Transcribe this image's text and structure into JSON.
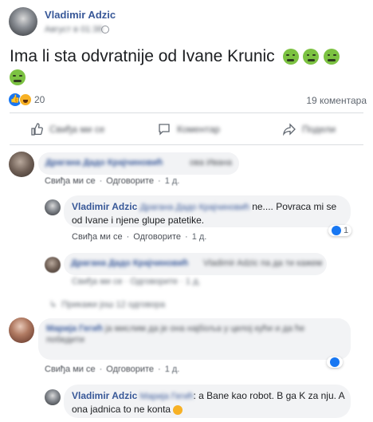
{
  "post": {
    "author": "Vladimir Adzic",
    "timestamp": "Август в 01:38",
    "text": "Ima li sta odvratnije od Ivane Krunic",
    "reaction_count": "20",
    "comments_count": "19 коментара"
  },
  "actions": {
    "like": "Свиђа ми се",
    "comment": "Коментар",
    "share": "Подели"
  },
  "comments": [
    {
      "author_blurred": "Драгана Дадо Крајчиновић",
      "text_blurred": "ова Ивана",
      "like_label": "Свиђа ми се",
      "reply_label": "Одговорите",
      "time": "1 д."
    },
    {
      "author": "Vladimir Adzic",
      "mention_blurred": "Драгана Дадо Крајчиновић",
      "text": "ne.... Povraca mi se od Ivane i njene glupe patetike.",
      "like_label": "Свиђа ми се",
      "reply_label": "Одговорите",
      "time": "1 д.",
      "likes": "1"
    },
    {
      "author_blurred": "Драгана Дадо Крајчиновић",
      "text_blurred": "Vladimir Adzic па да ти кажем",
      "meta_blurred": "Свиђа ми се · Одговорите · 1 д."
    },
    {
      "more_replies_blurred": "Прикажи још 12 одговора"
    },
    {
      "author_blurred": "Марија Гегић",
      "text_blurred": "ја мислим да је она најбоља у целој кући и да ће победити",
      "like_label": "Свиђа ми се",
      "reply_label": "Одговорите",
      "time": "1 д."
    },
    {
      "author": "Vladimir Adzic",
      "mention_blurred": "Марија Гегић",
      "text": ": a Bane kao robot. B ga K za nju. A ona jadnica to ne konta"
    }
  ],
  "colors": {
    "link": "#385898",
    "like_blue": "#1877f2",
    "nauseated": "#7cc242"
  }
}
